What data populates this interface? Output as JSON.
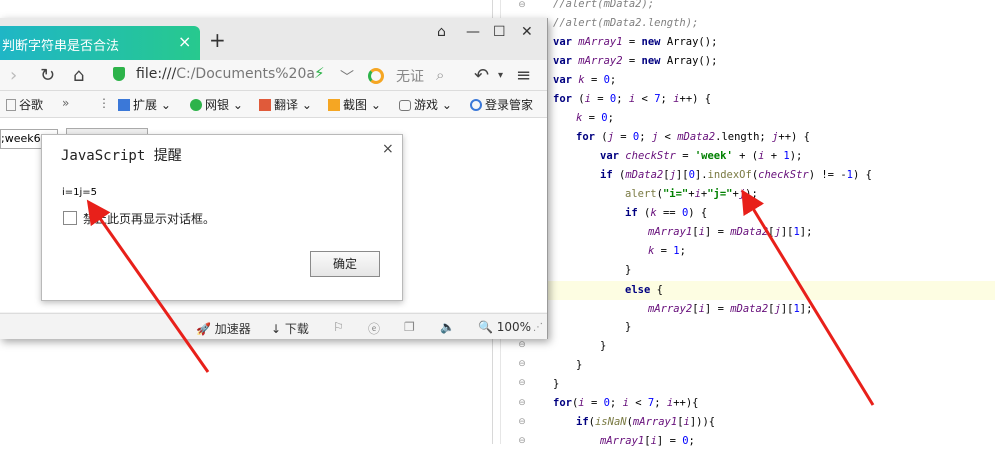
{
  "browser": {
    "tab_title": "判断字符串是否合法",
    "tab_close": "×",
    "new_tab": "+",
    "url_prefix": "file:///",
    "url_rest": "C:/Documents%20a",
    "search_placeholder": "无证",
    "bookmarks": [
      "谷歌",
      "扩展",
      "网银",
      "翻译",
      "截图",
      "游戏",
      "登录管家"
    ],
    "page_input_value": ";week6",
    "status": {
      "accelerator": "加速器",
      "download": "下载",
      "zoom": "100%"
    }
  },
  "dialog": {
    "title": "JavaScript 提醒",
    "close": "×",
    "message": "i=1j=5",
    "checkbox_label": "禁止此页再显示对话框。",
    "ok_label": "确定"
  },
  "code_lines": [
    "//alert(mData2);",
    "//alert(mData2.length);",
    "var mArray1 = new Array();",
    "var mArray2 = new Array();",
    "var k = 0;",
    "for (i = 0; i < 7; i++) {",
    "k = 0;",
    "for (j = 0; j < mData2.length; j++) {",
    "var checkStr = 'week' + (i + 1);",
    "if (mData2[j][0].indexOf(checkStr) != -1) {",
    "alert(\"i=\"+i+\"j=\"+j);",
    "if (k == 0) {",
    "mArray1[i] = mData2[j][1];",
    "k = 1;",
    "}",
    "else {",
    "mArray2[i] = mData2[j][1];",
    "}",
    "}",
    "}",
    "}",
    "for(i = 0; i < 7; i++){",
    "if(isNaN(mArray1[i])){",
    "mArray1[i] = 0;"
  ]
}
